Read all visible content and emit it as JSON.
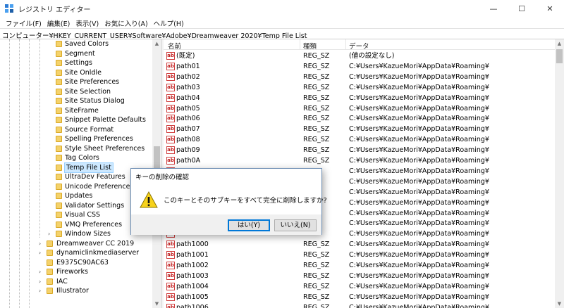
{
  "window": {
    "title": "レジストリ エディター",
    "minimize": "—",
    "maximize": "☐",
    "close": "✕"
  },
  "menu": [
    "ファイル(F)",
    "編集(E)",
    "表示(V)",
    "お気に入り(A)",
    "ヘルプ(H)"
  ],
  "address": "コンピューター¥HKEY_CURRENT_USER¥Software¥Adobe¥Dreamweaver 2020¥Temp File List",
  "tree": {
    "children": [
      "Saved Colors",
      "Segment",
      "Settings",
      "Site Onldle",
      "Site Preferences",
      "Site Selection",
      "Site Status Dialog",
      "SiteFrame",
      "Snippet Palette Defaults",
      "Source Format",
      "Spelling Preferences",
      "Style Sheet Preferences",
      "Tag Colors",
      "Temp File List",
      "UltraDev Features",
      "Unicode Preferences",
      "Updates",
      "Validator Settings",
      "Visual CSS",
      "VMQ Preferences",
      "Window Sizes"
    ],
    "selected": "Temp File List",
    "siblings": [
      "Dreamweaver CC 2019",
      "dynamiclinkmediaserver",
      "E9375C90AC63",
      "Fireworks",
      "IAC",
      "Illustrator"
    ]
  },
  "list": {
    "headers": {
      "name": "名前",
      "type": "種類",
      "data": "データ"
    },
    "rows": [
      {
        "name": "(既定)",
        "type": "REG_SZ",
        "data": "(値の設定なし)"
      },
      {
        "name": "path01",
        "type": "REG_SZ",
        "data": "C:¥Users¥KazueMori¥AppData¥Roaming¥"
      },
      {
        "name": "path02",
        "type": "REG_SZ",
        "data": "C:¥Users¥KazueMori¥AppData¥Roaming¥"
      },
      {
        "name": "path03",
        "type": "REG_SZ",
        "data": "C:¥Users¥KazueMori¥AppData¥Roaming¥"
      },
      {
        "name": "path04",
        "type": "REG_SZ",
        "data": "C:¥Users¥KazueMori¥AppData¥Roaming¥"
      },
      {
        "name": "path05",
        "type": "REG_SZ",
        "data": "C:¥Users¥KazueMori¥AppData¥Roaming¥"
      },
      {
        "name": "path06",
        "type": "REG_SZ",
        "data": "C:¥Users¥KazueMori¥AppData¥Roaming¥"
      },
      {
        "name": "path07",
        "type": "REG_SZ",
        "data": "C:¥Users¥KazueMori¥AppData¥Roaming¥"
      },
      {
        "name": "path08",
        "type": "REG_SZ",
        "data": "C:¥Users¥KazueMori¥AppData¥Roaming¥"
      },
      {
        "name": "path09",
        "type": "REG_SZ",
        "data": "C:¥Users¥KazueMori¥AppData¥Roaming¥"
      },
      {
        "name": "path0A",
        "type": "REG_SZ",
        "data": "C:¥Users¥KazueMori¥AppData¥Roaming¥"
      },
      {
        "name": "",
        "type": "",
        "data": "C:¥Users¥KazueMori¥AppData¥Roaming¥"
      },
      {
        "name": "",
        "type": "",
        "data": "C:¥Users¥KazueMori¥AppData¥Roaming¥"
      },
      {
        "name": "",
        "type": "",
        "data": "C:¥Users¥KazueMori¥AppData¥Roaming¥"
      },
      {
        "name": "",
        "type": "",
        "data": "C:¥Users¥KazueMori¥AppData¥Roaming¥"
      },
      {
        "name": "",
        "type": "",
        "data": "C:¥Users¥KazueMori¥AppData¥Roaming¥"
      },
      {
        "name": "",
        "type": "",
        "data": "C:¥Users¥KazueMori¥AppData¥Roaming¥"
      },
      {
        "name": "",
        "type": "",
        "data": "C:¥Users¥KazueMori¥AppData¥Roaming¥"
      },
      {
        "name": "path1000",
        "type": "REG_SZ",
        "data": "C:¥Users¥KazueMori¥AppData¥Roaming¥"
      },
      {
        "name": "path1001",
        "type": "REG_SZ",
        "data": "C:¥Users¥KazueMori¥AppData¥Roaming¥"
      },
      {
        "name": "path1002",
        "type": "REG_SZ",
        "data": "C:¥Users¥KazueMori¥AppData¥Roaming¥"
      },
      {
        "name": "path1003",
        "type": "REG_SZ",
        "data": "C:¥Users¥KazueMori¥AppData¥Roaming¥"
      },
      {
        "name": "path1004",
        "type": "REG_SZ",
        "data": "C:¥Users¥KazueMori¥AppData¥Roaming¥"
      },
      {
        "name": "path1005",
        "type": "REG_SZ",
        "data": "C:¥Users¥KazueMori¥AppData¥Roaming¥"
      },
      {
        "name": "path1006",
        "type": "REG_SZ",
        "data": "C:¥Users¥KazueMori¥AppData¥Roaming¥"
      }
    ]
  },
  "dialog": {
    "title": "キーの削除の確認",
    "message": "このキーとそのサブキーをすべて完全に削除しますか?",
    "yes": "はい(Y)",
    "no": "いいえ(N)"
  }
}
